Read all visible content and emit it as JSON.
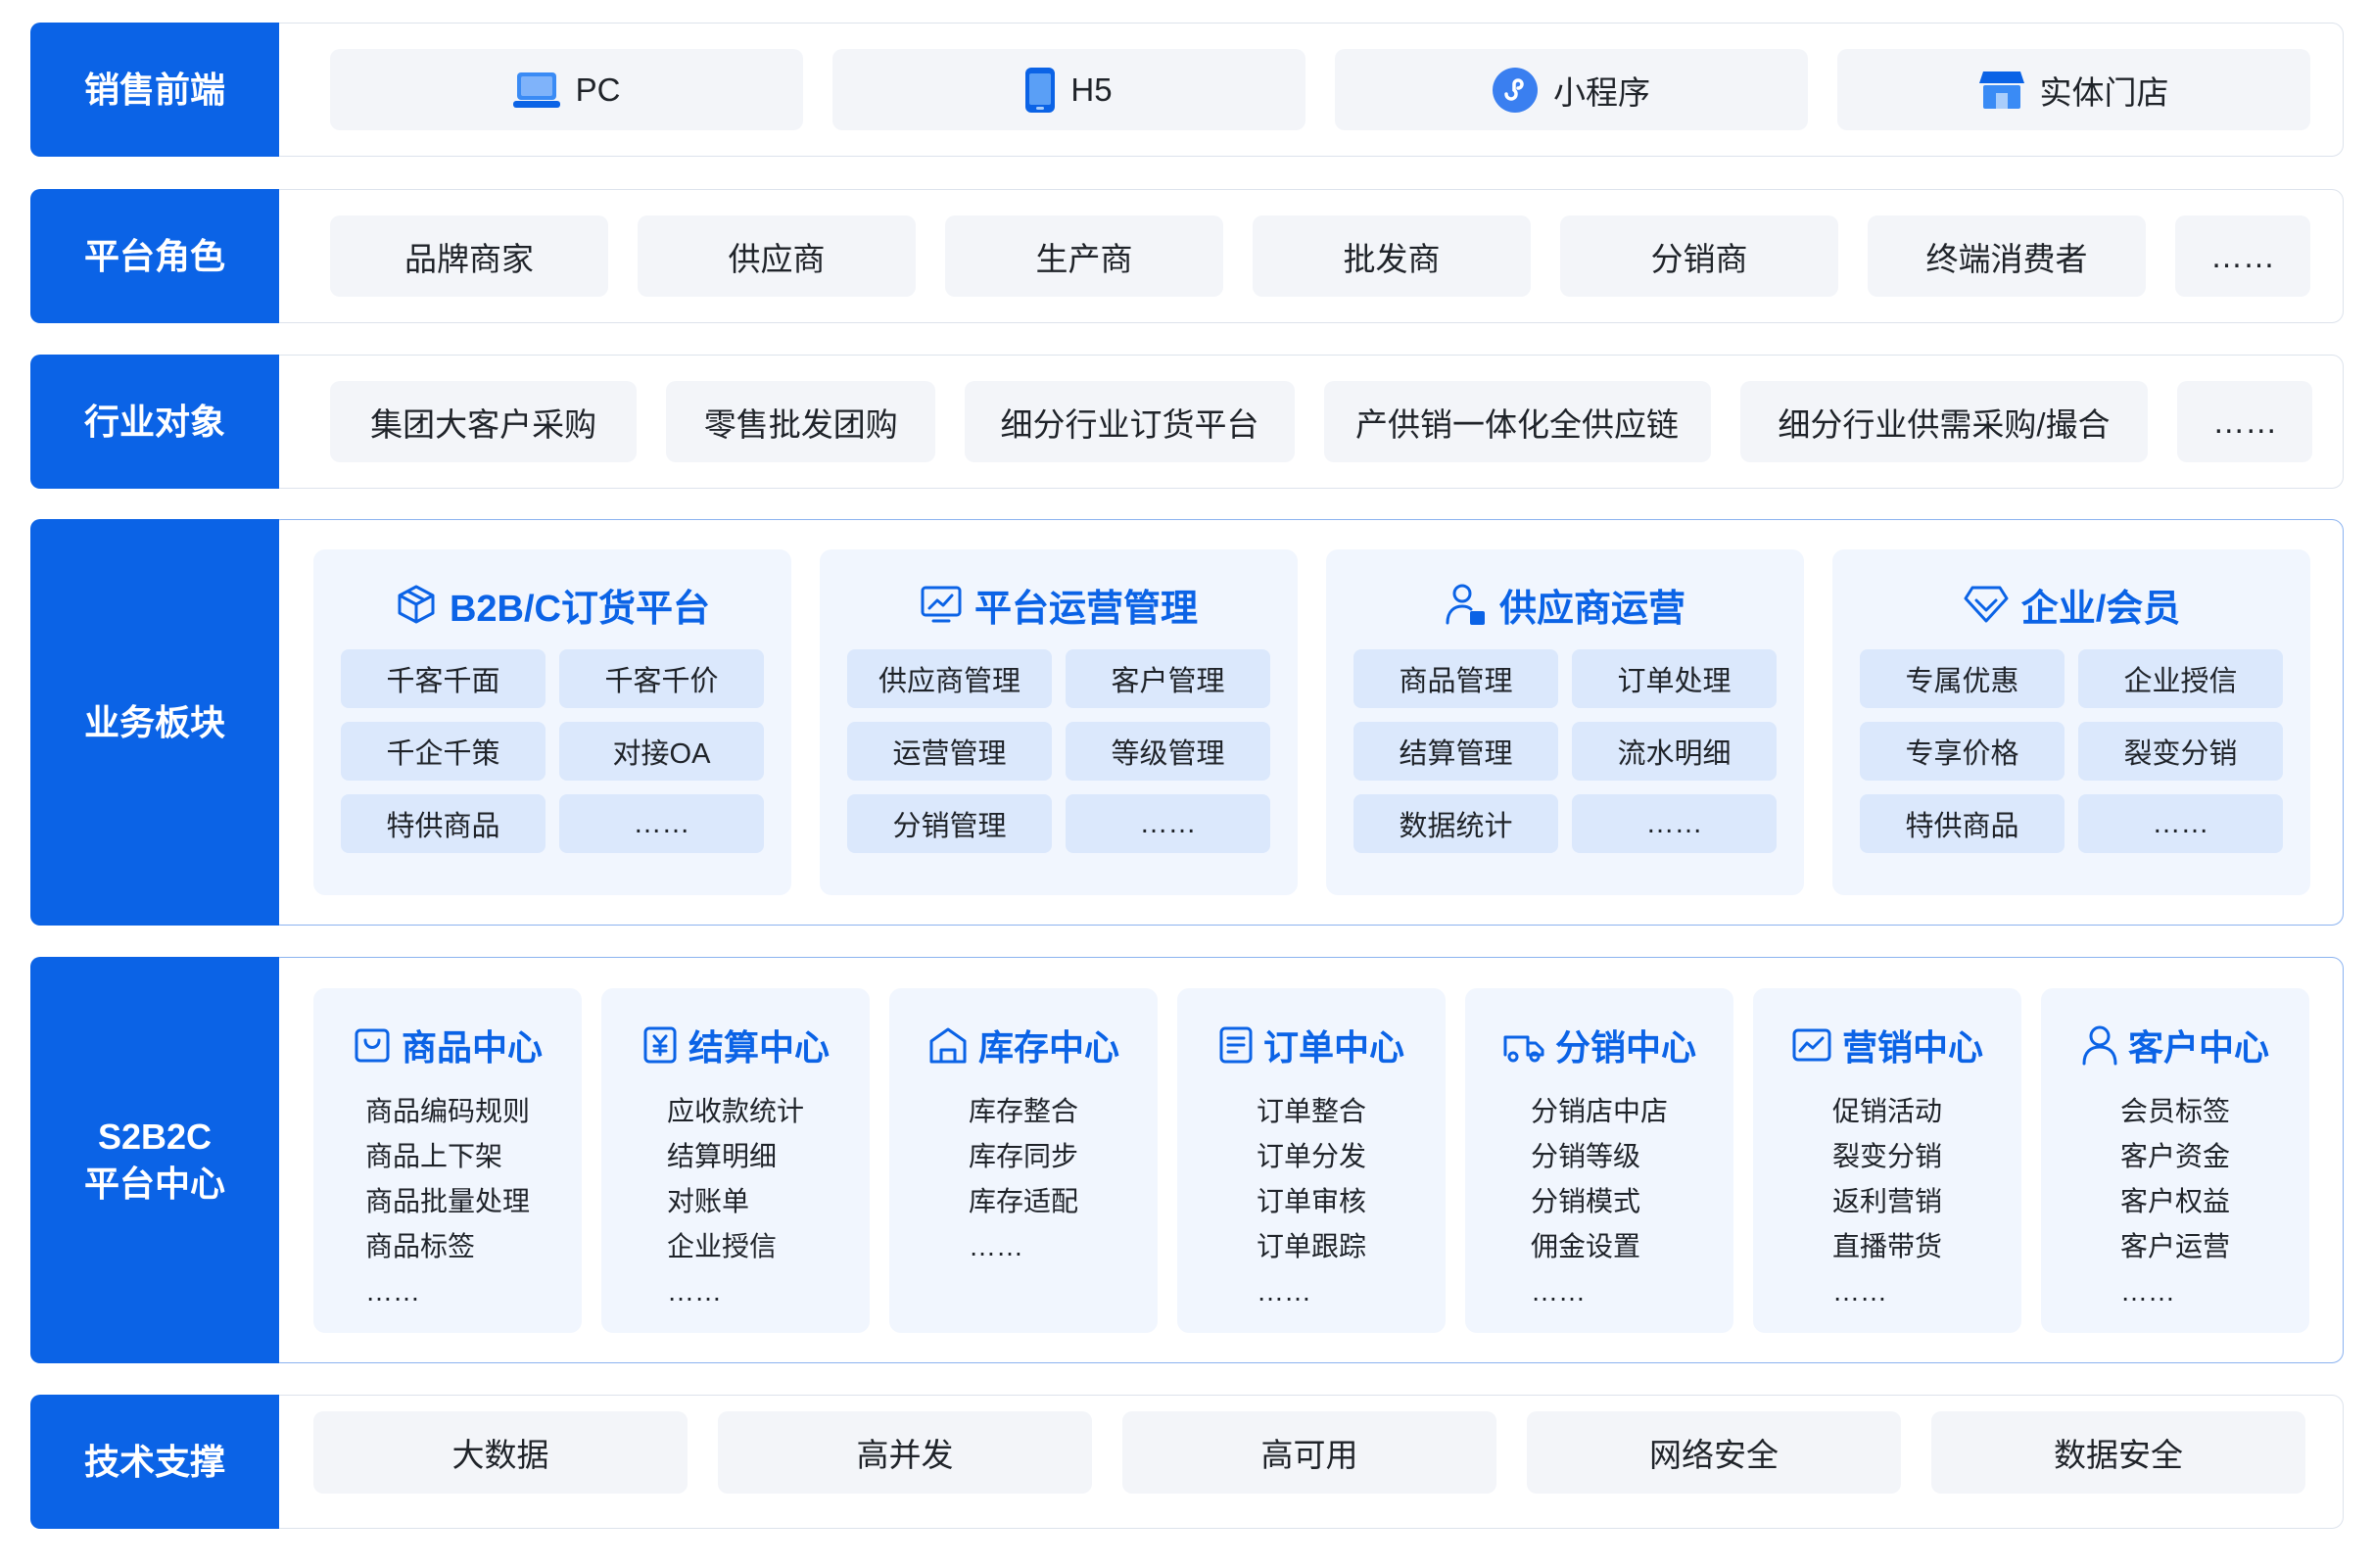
{
  "rows": {
    "sales_frontend": {
      "label": "销售前端",
      "items": [
        {
          "label": "PC",
          "icon": "laptop-icon"
        },
        {
          "label": "H5",
          "icon": "mobile-phone-icon"
        },
        {
          "label": "小程序",
          "icon": "mini-program-icon"
        },
        {
          "label": "实体门店",
          "icon": "store-icon"
        }
      ]
    },
    "platform_roles": {
      "label": "平台角色",
      "items": [
        "品牌商家",
        "供应商",
        "生产商",
        "批发商",
        "分销商",
        "终端消费者",
        "……"
      ]
    },
    "industry_targets": {
      "label": "行业对象",
      "items": [
        "集团大客户采购",
        "零售批发团购",
        "细分行业订货平台",
        "产供销一体化全供应链",
        "细分行业供需采购/撮合",
        "……"
      ]
    },
    "business_modules": {
      "label": "业务板块",
      "cards": [
        {
          "title": "B2B/C订货平台",
          "icon": "cube-box-icon",
          "items": [
            "千客千面",
            "千客千价",
            "千企千策",
            "对接OA",
            "特供商品",
            "……"
          ]
        },
        {
          "title": "平台运营管理",
          "icon": "monitor-chart-icon",
          "items": [
            "供应商管理",
            "客户管理",
            "运营管理",
            "等级管理",
            "分销管理",
            "……"
          ]
        },
        {
          "title": "供应商运营",
          "icon": "supplier-person-icon",
          "items": [
            "商品管理",
            "订单处理",
            "结算管理",
            "流水明细",
            "数据统计",
            "……"
          ]
        },
        {
          "title": "企业/会员",
          "icon": "diamond-icon",
          "items": [
            "专属优惠",
            "企业授信",
            "专享价格",
            "裂变分销",
            "特供商品",
            "……"
          ]
        }
      ]
    },
    "platform_center": {
      "label": "S2B2C\n平台中心",
      "cards": [
        {
          "title": "商品中心",
          "icon": "shopping-bag-icon",
          "items": [
            "商品编码规则",
            "商品上下架",
            "商品批量处理",
            "商品标签",
            "……"
          ]
        },
        {
          "title": "结算中心",
          "icon": "yuan-document-icon",
          "items": [
            "应收款统计",
            "结算明细",
            "对账单",
            "企业授信",
            "……"
          ]
        },
        {
          "title": "库存中心",
          "icon": "warehouse-icon",
          "items": [
            "库存整合",
            "库存同步",
            "库存适配",
            "……"
          ]
        },
        {
          "title": "订单中心",
          "icon": "order-list-icon",
          "items": [
            "订单整合",
            "订单分发",
            "订单审核",
            "订单跟踪",
            "……"
          ]
        },
        {
          "title": "分销中心",
          "icon": "delivery-truck-icon",
          "items": [
            "分销店中店",
            "分销等级",
            "分销模式",
            "佣金设置",
            "……"
          ]
        },
        {
          "title": "营销中心",
          "icon": "trend-chart-icon",
          "items": [
            "促销活动",
            "裂变分销",
            "返利营销",
            "直播带货",
            "……"
          ]
        },
        {
          "title": "客户中心",
          "icon": "customer-person-icon",
          "items": [
            "会员标签",
            "客户资金",
            "客户权益",
            "客户运营",
            "……"
          ]
        }
      ]
    },
    "tech_support": {
      "label": "技术支撑",
      "items": [
        "大数据",
        "高并发",
        "高可用",
        "网络安全",
        "数据安全"
      ]
    }
  },
  "colors": {
    "primary": "#0b63e6",
    "chip": "#dbe8fc",
    "card": "#f1f6fe",
    "pill": "#f3f5f9"
  }
}
